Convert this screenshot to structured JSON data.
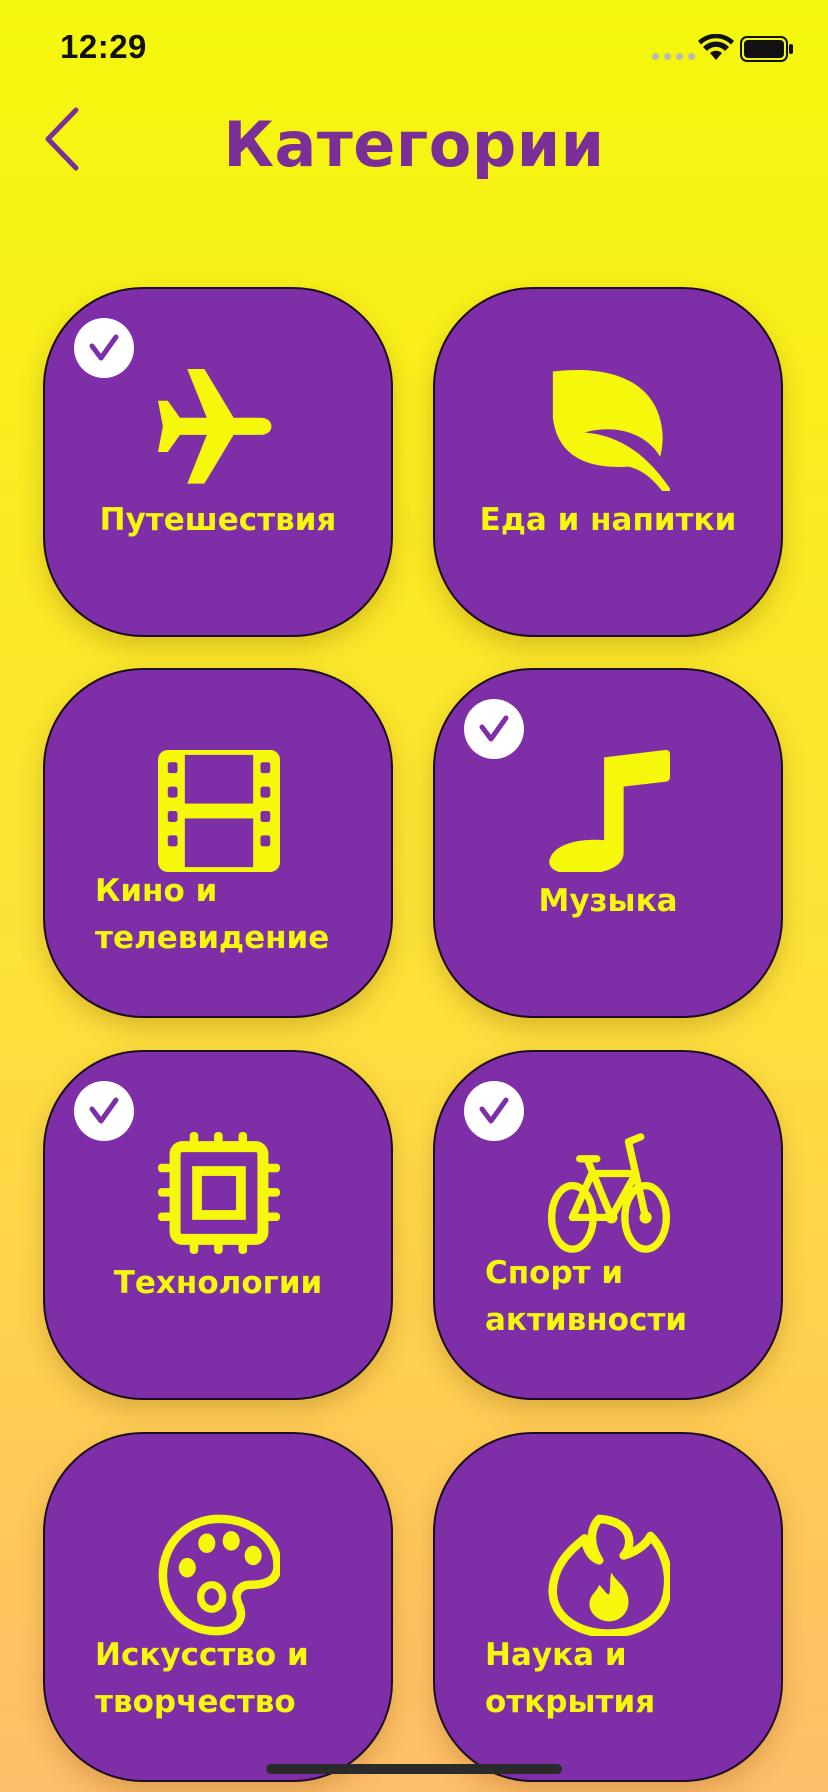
{
  "status_bar": {
    "time": "12:29"
  },
  "header": {
    "title": "Категории"
  },
  "categories": [
    {
      "label": "Путешествия",
      "icon": "airplane-icon",
      "selected": true
    },
    {
      "label": "Еда и напитки",
      "icon": "leaf-icon",
      "selected": false
    },
    {
      "label": "Кино и телевидение",
      "line1": "Кино и",
      "line2": "телевидение",
      "icon": "film-icon",
      "selected": false
    },
    {
      "label": "Музыка",
      "icon": "music-note-icon",
      "selected": true
    },
    {
      "label": "Технологии",
      "icon": "chip-icon",
      "selected": true
    },
    {
      "label": "Спорт и активности",
      "line1": "Спорт и",
      "line2": "активности",
      "icon": "bicycle-icon",
      "selected": true
    },
    {
      "label": "Искусство и творчество",
      "line1": "Искусство и",
      "line2": "творчество",
      "icon": "palette-icon",
      "selected": false
    },
    {
      "label": "Наука и открытия",
      "line1": "Наука и",
      "line2": "открытия",
      "icon": "flame-icon",
      "selected": false
    }
  ],
  "colors": {
    "accent_purple": "#7e2ea6",
    "accent_yellow": "#f6f80c",
    "title_purple": "#7a2e98"
  }
}
